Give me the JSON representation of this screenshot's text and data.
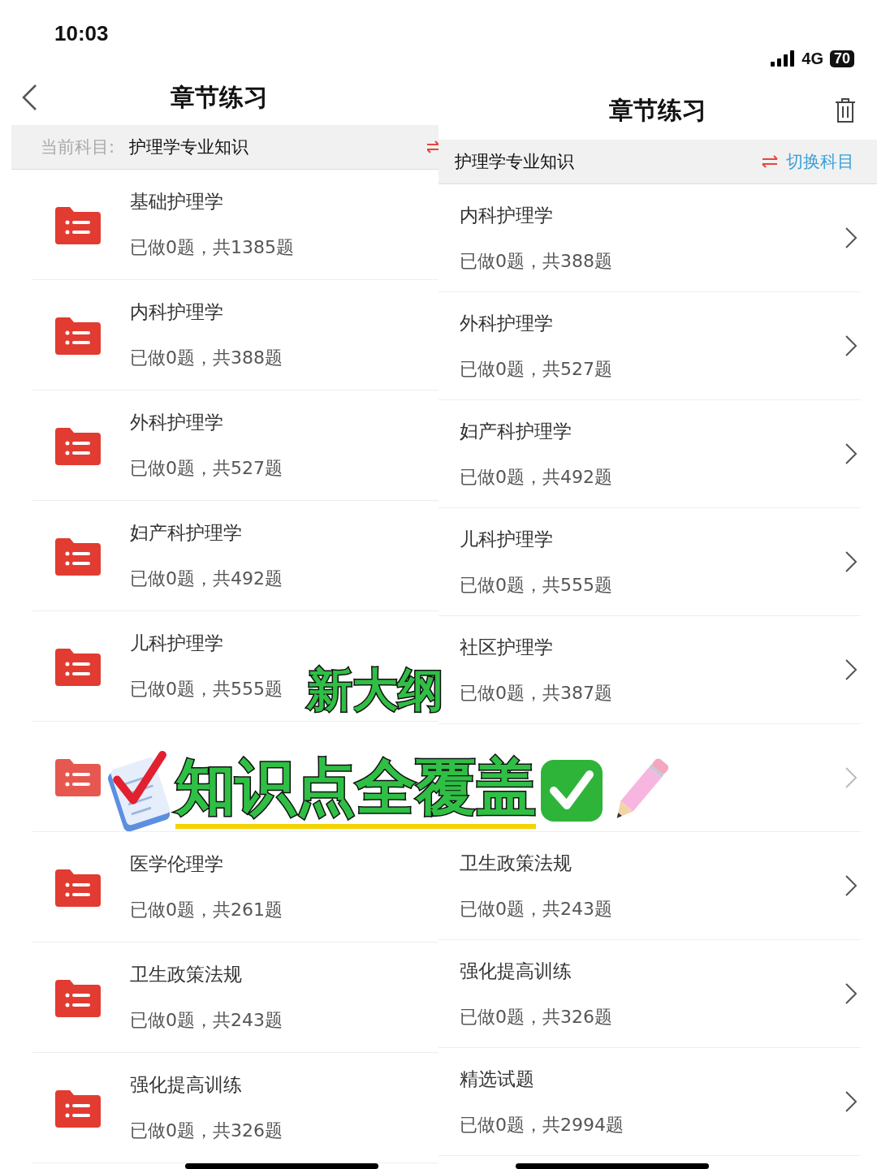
{
  "left_screen": {
    "status_bar": {
      "time": "10:03"
    },
    "nav": {
      "title": "章节练习"
    },
    "subject_bar": {
      "label": "当前科目:",
      "subject": "护理学专业知识"
    },
    "chapters": [
      {
        "covered": false,
        "title": "基础护理学",
        "progress": "已做0题，共1385题"
      },
      {
        "covered": false,
        "title": "内科护理学",
        "progress": "已做0题，共388题"
      },
      {
        "covered": false,
        "title": "外科护理学",
        "progress": "已做0题，共527题"
      },
      {
        "covered": false,
        "title": "妇产科护理学",
        "progress": "已做0题，共492题"
      },
      {
        "covered": false,
        "title": "儿科护理学",
        "progress": "已做0题，共555题"
      },
      {
        "covered": true
      },
      {
        "covered": false,
        "title": "医学伦理学",
        "progress": "已做0题，共261题"
      },
      {
        "covered": false,
        "title": "卫生政策法规",
        "progress": "已做0题，共243题"
      },
      {
        "covered": false,
        "title": "强化提高训练",
        "progress": "已做0题，共326题"
      }
    ]
  },
  "right_screen": {
    "status_bar": {
      "network": "4G",
      "battery": "70"
    },
    "nav": {
      "title": "章节练习"
    },
    "subject_bar": {
      "subject": "护理学专业知识",
      "switch_label": "切换科目"
    },
    "chapters": [
      {
        "covered": false,
        "title": "内科护理学",
        "progress": "已做0题，共388题"
      },
      {
        "covered": false,
        "title": "外科护理学",
        "progress": "已做0题，共527题"
      },
      {
        "covered": false,
        "title": "妇产科护理学",
        "progress": "已做0题，共492题"
      },
      {
        "covered": false,
        "title": "儿科护理学",
        "progress": "已做0题，共555题"
      },
      {
        "covered": false,
        "title": "社区护理学",
        "progress": "已做0题，共387题"
      },
      {
        "covered": true
      },
      {
        "covered": false,
        "title": "卫生政策法规",
        "progress": "已做0题，共243题"
      },
      {
        "covered": false,
        "title": "强化提高训练",
        "progress": "已做0题，共326题"
      },
      {
        "covered": false,
        "title": "精选试题",
        "progress": "已做0题，共2994题"
      }
    ]
  },
  "overlay": {
    "headline": "新大纲",
    "tagline": "知识点全覆盖"
  }
}
